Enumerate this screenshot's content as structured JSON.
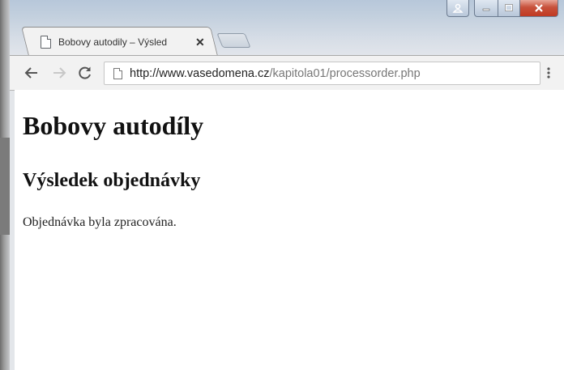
{
  "tab": {
    "title": "Bobovy autodily – Výsled",
    "close_glyph": "✕"
  },
  "toolbar": {
    "url_domain": "http://www.vasedomena.cz",
    "url_path": "/kapitola01/processorder.php"
  },
  "page": {
    "heading": "Bobovy autodíly",
    "subheading": "Výsledek objednávky",
    "message": "Objednávka byla zpracována."
  }
}
